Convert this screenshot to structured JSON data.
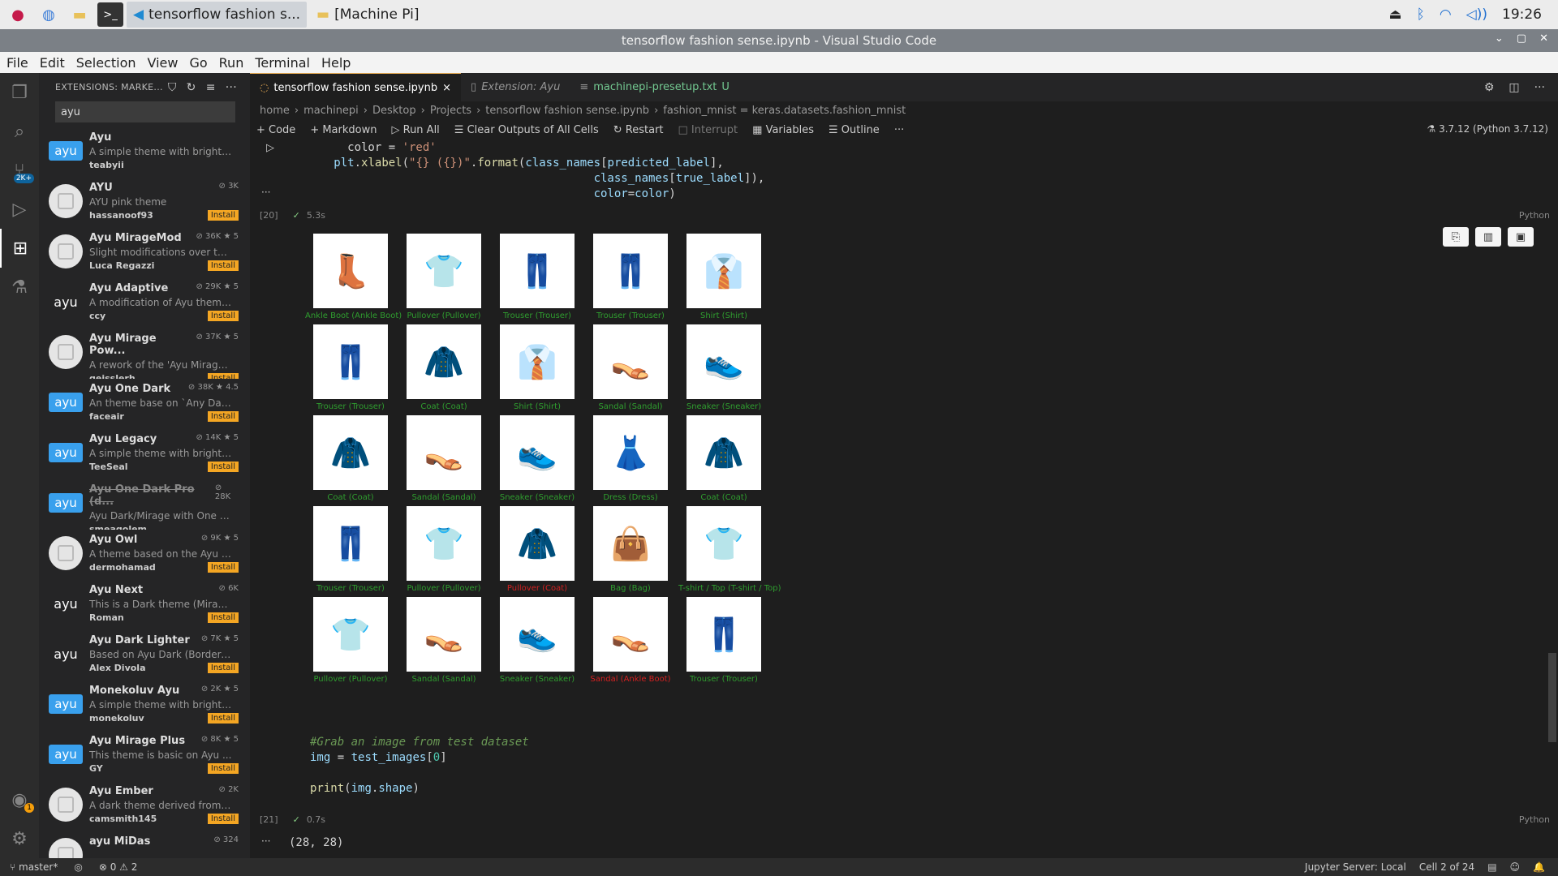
{
  "taskbar": {
    "tasks": [
      "tensorflow fashion s...",
      "[Machine Pi]"
    ],
    "time": "19:26"
  },
  "window": {
    "title": "tensorflow fashion sense.ipynb - Visual Studio Code"
  },
  "menu": [
    "File",
    "Edit",
    "Selection",
    "View",
    "Go",
    "Run",
    "Terminal",
    "Help"
  ],
  "activity": {
    "badge_ext": "2K+",
    "badge_account": "1"
  },
  "sidebar": {
    "header": "EXTENSIONS: MARKE...",
    "search_value": "ayu",
    "extensions": [
      {
        "name": "Ayu",
        "meta": "",
        "desc": "A simple theme with bright c...",
        "publisher": "teabyii",
        "install": "",
        "logo": "ayu",
        "logo_style": "blue"
      },
      {
        "name": "AYU",
        "meta": "⊘ 3K",
        "desc": "AYU pink theme",
        "publisher": "hassanoof93",
        "install": "Install",
        "logo": "",
        "logo_style": "gray"
      },
      {
        "name": "Ayu MirageMod",
        "meta": "⊘ 36K ★ 5",
        "desc": "Slight modifications over the...",
        "publisher": "Luca Regazzi",
        "install": "Install",
        "logo": "",
        "logo_style": "gray"
      },
      {
        "name": "Ayu Adaptive",
        "meta": "⊘ 29K ★ 5",
        "desc": "A modification of Ayu theme...",
        "publisher": "ccy",
        "install": "Install",
        "logo": "ayu",
        "logo_style": "text"
      },
      {
        "name": "Ayu Mirage Pow...",
        "meta": "⊘ 37K ★ 5",
        "desc": "A rework of the 'Ayu Mirage' t...",
        "publisher": "geisslerh",
        "install": "Install",
        "logo": "",
        "logo_style": "gray"
      },
      {
        "name": "Ayu One Dark",
        "meta": "⊘ 38K ★ 4.5",
        "desc": "An theme base on `Any Dark...",
        "publisher": "faceair",
        "install": "Install",
        "logo": "ayu",
        "logo_style": "blue"
      },
      {
        "name": "Ayu Legacy",
        "meta": "⊘ 14K ★ 5",
        "desc": "A simple theme with bright c...",
        "publisher": "TeeSeal",
        "install": "Install",
        "logo": "ayu",
        "logo_style": "blue"
      },
      {
        "name": "Ayu One Dark Pro (d...",
        "meta": "⊘ 28K",
        "desc": "Ayu Dark/Mirage with One D...",
        "publisher": "smeagolem",
        "install": "",
        "logo": "ayu",
        "logo_style": "blue"
      },
      {
        "name": "Ayu Owl",
        "meta": "⊘ 9K ★ 5",
        "desc": "A theme based on the Ayu M...",
        "publisher": "dermohamad",
        "install": "Install",
        "logo": "",
        "logo_style": "gray"
      },
      {
        "name": "Ayu Next",
        "meta": "⊘ 6K",
        "desc": " This is a Dark theme (Mirag...",
        "publisher": "Roman",
        "install": "Install",
        "logo": "ayu",
        "logo_style": "text"
      },
      {
        "name": "Ayu Dark Lighter",
        "meta": "⊘ 7K ★ 5",
        "desc": "Based on Ayu Dark (Bordere...",
        "publisher": "Alex Divola",
        "install": "Install",
        "logo": "ayu",
        "logo_style": "text"
      },
      {
        "name": "Monekoluv Ayu",
        "meta": "⊘ 2K ★ 5",
        "desc": "A simple theme with bright c...",
        "publisher": "monekoluv",
        "install": "Install",
        "logo": "ayu",
        "logo_style": "blue"
      },
      {
        "name": "Ayu Mirage Plus",
        "meta": "⊘ 8K ★ 5",
        "desc": "This theme is basic on Ayu ...",
        "publisher": "GY",
        "install": "Install",
        "logo": "ayu",
        "logo_style": "blue"
      },
      {
        "name": "Ayu Ember",
        "meta": "⊘ 2K",
        "desc": "A dark theme derived from A...",
        "publisher": "camsmith145",
        "install": "Install",
        "logo": "",
        "logo_style": "gray"
      },
      {
        "name": "ayu MiDas",
        "meta": "⊘ 324",
        "desc": "",
        "publisher": "",
        "install": "",
        "logo": "",
        "logo_style": "gray"
      }
    ]
  },
  "editor": {
    "tabs": [
      {
        "label": "tensorflow fashion sense.ipynb",
        "close": "×",
        "active": true
      },
      {
        "label": "Extension: Ayu",
        "close": "",
        "active": false
      },
      {
        "label": "machinepi-presetup.txt",
        "close": "U",
        "active": false
      }
    ],
    "breadcrumb": [
      "home",
      "machinepi",
      "Desktop",
      "Projects",
      "tensorflow fashion sense.ipynb",
      "fashion_mnist = keras.datasets.fashion_mnist"
    ],
    "toolbar": [
      "+ Code",
      "+ Markdown",
      "▷ Run All",
      "☰ Clear Outputs of All Cells",
      "↻ Restart",
      "□ Interrupt",
      "▦ Variables",
      "☰ Outline",
      "···"
    ],
    "kernel": "3.7.12 (Python 3.7.12)",
    "cell1": {
      "exec": "[20]",
      "time": "5.3s",
      "lang": "Python"
    },
    "cell2": {
      "exec": "[21]",
      "time": "0.7s",
      "lang": "Python",
      "output": "(28, 28)"
    }
  },
  "predictions": [
    {
      "label": "Ankle Boot (Ankle Boot)",
      "correct": true,
      "icon": "ankle-boot-icon",
      "glyph": "👢"
    },
    {
      "label": "Pullover (Pullover)",
      "correct": true,
      "icon": "pullover-icon",
      "glyph": "👕"
    },
    {
      "label": "Trouser (Trouser)",
      "correct": true,
      "icon": "trouser-icon",
      "glyph": "👖"
    },
    {
      "label": "Trouser (Trouser)",
      "correct": true,
      "icon": "trouser-icon",
      "glyph": "👖"
    },
    {
      "label": "Shirt (Shirt)",
      "correct": true,
      "icon": "shirt-icon",
      "glyph": "👔"
    },
    {
      "label": "Trouser (Trouser)",
      "correct": true,
      "icon": "trouser-icon",
      "glyph": "👖"
    },
    {
      "label": "Coat (Coat)",
      "correct": true,
      "icon": "coat-icon",
      "glyph": "🧥"
    },
    {
      "label": "Shirt (Shirt)",
      "correct": true,
      "icon": "shirt-icon",
      "glyph": "👔"
    },
    {
      "label": "Sandal (Sandal)",
      "correct": true,
      "icon": "sandal-icon",
      "glyph": "👡"
    },
    {
      "label": "Sneaker (Sneaker)",
      "correct": true,
      "icon": "sneaker-icon",
      "glyph": "👟"
    },
    {
      "label": "Coat (Coat)",
      "correct": true,
      "icon": "coat-icon",
      "glyph": "🧥"
    },
    {
      "label": "Sandal (Sandal)",
      "correct": true,
      "icon": "sandal-icon",
      "glyph": "👡"
    },
    {
      "label": "Sneaker (Sneaker)",
      "correct": true,
      "icon": "sneaker-icon",
      "glyph": "👟"
    },
    {
      "label": "Dress (Dress)",
      "correct": true,
      "icon": "dress-icon",
      "glyph": "👗"
    },
    {
      "label": "Coat (Coat)",
      "correct": true,
      "icon": "coat-icon",
      "glyph": "🧥"
    },
    {
      "label": "Trouser (Trouser)",
      "correct": true,
      "icon": "trouser-icon",
      "glyph": "👖"
    },
    {
      "label": "Pullover (Pullover)",
      "correct": true,
      "icon": "pullover-icon",
      "glyph": "👕"
    },
    {
      "label": "Pullover (Coat)",
      "correct": false,
      "icon": "pullover-icon",
      "glyph": "🧥"
    },
    {
      "label": "Bag (Bag)",
      "correct": true,
      "icon": "bag-icon",
      "glyph": "👜"
    },
    {
      "label": "T-shirt / Top (T-shirt / Top)",
      "correct": true,
      "icon": "tshirt-icon",
      "glyph": "👕"
    },
    {
      "label": "Pullover (Pullover)",
      "correct": true,
      "icon": "pullover-icon",
      "glyph": "👕"
    },
    {
      "label": "Sandal (Sandal)",
      "correct": true,
      "icon": "sandal-icon",
      "glyph": "👡"
    },
    {
      "label": "Sneaker (Sneaker)",
      "correct": true,
      "icon": "sneaker-icon",
      "glyph": "👟"
    },
    {
      "label": "Sandal (Ankle Boot)",
      "correct": false,
      "icon": "sandal-icon",
      "glyph": "👡"
    },
    {
      "label": "Trouser (Trouser)",
      "correct": true,
      "icon": "trouser-icon",
      "glyph": "👖"
    }
  ],
  "status": {
    "branch": "master*",
    "problems": "⊗ 0 ⚠ 2",
    "jupyter": "Jupyter Server: Local",
    "cell": "Cell 2 of 24"
  },
  "colors": {
    "correct": "#2f9e2f",
    "wrong": "#d32020",
    "install": "#f4a623"
  }
}
